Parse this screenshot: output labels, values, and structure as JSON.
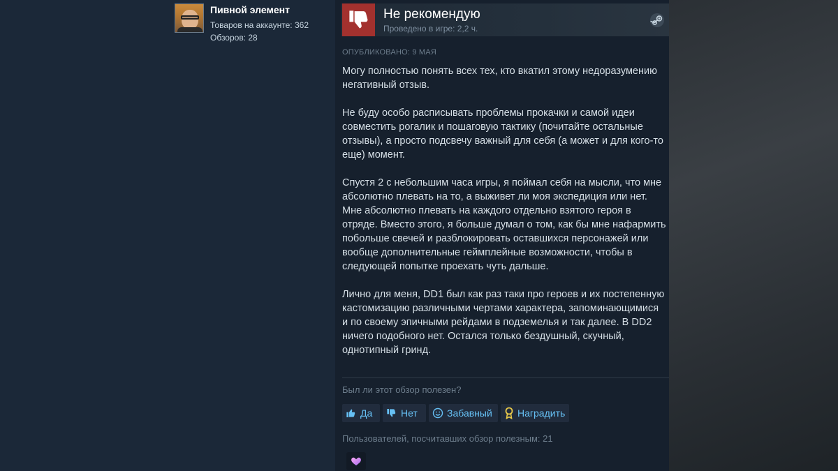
{
  "author": {
    "name": "Пивной элемент",
    "products": "Товаров на аккаунте: 362",
    "reviews": "Обзоров: 28"
  },
  "review": {
    "verdict": "Не рекомендую",
    "hours": "Проведено в игре: 2,2 ч.",
    "posted": "ОПУБЛИКОВАНО: 9 МАЯ",
    "paragraphs": [
      "Могу полностью понять всех тех, кто вкатил этому недоразумению негативный отзыв.",
      "Не буду особо расписывать проблемы прокачки и самой идеи совместить рогалик и пошаговую тактику (почитайте остальные отзывы), а просто подсвечу важный для себя (а может и для кого-то еще) момент.",
      "Спустя 2 с небольшим часа игры, я поймал себя на мысли, что мне абсолютно плевать на то, а выживет ли моя экспедиция или нет. Мне абсолютно плевать на каждого отдельно взятого героя в отряде. Вместо этого, я больше думал о том, как бы мне нафармить побольше свечей и разблокировать оставшихся персонажей или вообще дополнительные геймплейные возможности, чтобы в следующей попытке проехать чуть дальше.",
      "Лично для меня, DD1 был как раз таки про героев и их постепенную кастомизацию различными чертами характера, запоминающимися и по своему эпичными рейдами в подземелья и так далее. В DD2 ничего подобного нет. Остался только бездушный, скучный, однотипный гринд."
    ]
  },
  "feedback": {
    "question": "Был ли этот обзор полезен?",
    "yes": "Да",
    "no": "Нет",
    "funny": "Забавный",
    "award": "Наградить",
    "helpful_count": "Пользователей, посчитавших обзор полезным: 21"
  },
  "colors": {
    "background": "#1b2838",
    "thumb_down": "#a3312e",
    "link": "#66c0f4"
  },
  "icons": {
    "verdict": "thumbs-down-icon",
    "platform": "steam-icon",
    "yes": "thumbs-up-icon",
    "no": "thumbs-down-icon",
    "funny": "smiley-icon",
    "award": "award-icon",
    "received_award": "heart-award-icon"
  }
}
